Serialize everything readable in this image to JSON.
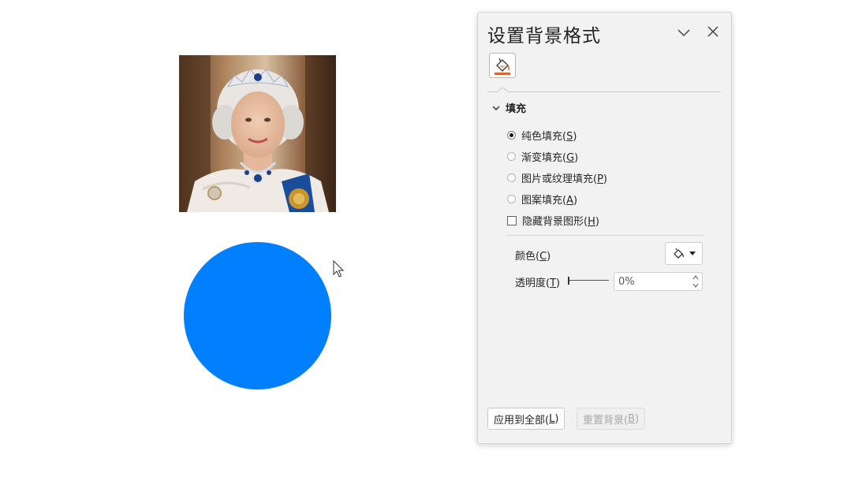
{
  "colors": {
    "circle_fill": "#0080ff",
    "pane_bg": "#f2f2f2",
    "fill_icon_accent": "#d46b2a"
  },
  "canvas": {
    "photo": {
      "subject": "portrait-photo"
    },
    "shape": {
      "kind": "circle"
    },
    "cursor_icon": "arrow-pointer-icon"
  },
  "pane": {
    "title": "设置背景格式",
    "collapse_icon": "chevron-down-icon",
    "close_icon": "close-icon",
    "tab_icon": "paint-bucket-icon",
    "section": {
      "label": "填充",
      "expander_icon": "chevron-down-icon"
    },
    "options": [
      {
        "text": "纯色填充(",
        "key": "S",
        "end": ")",
        "selected": true
      },
      {
        "text": "渐变填充(",
        "key": "G",
        "end": ")",
        "selected": false
      },
      {
        "text": "图片或纹理填充(",
        "key": "P",
        "end": ")",
        "selected": false
      },
      {
        "text": "图案填充(",
        "key": "A",
        "end": ")",
        "selected": false
      }
    ],
    "hide_graphics": {
      "text": "隐藏背景图形(",
      "key": "H",
      "end": ")",
      "checked": false
    },
    "color": {
      "label": "颜色(",
      "key": "C",
      "end": ")",
      "icon": "paint-bucket-icon"
    },
    "transparency": {
      "label": "透明度(",
      "key": "T",
      "end": ")",
      "value": "0%",
      "level": 0
    },
    "footer": {
      "apply_all": {
        "text": "应用到全部(",
        "key": "L",
        "end": ")"
      },
      "reset": {
        "text": "重置背景(",
        "key": "B",
        "end": ")",
        "disabled": true
      }
    }
  }
}
